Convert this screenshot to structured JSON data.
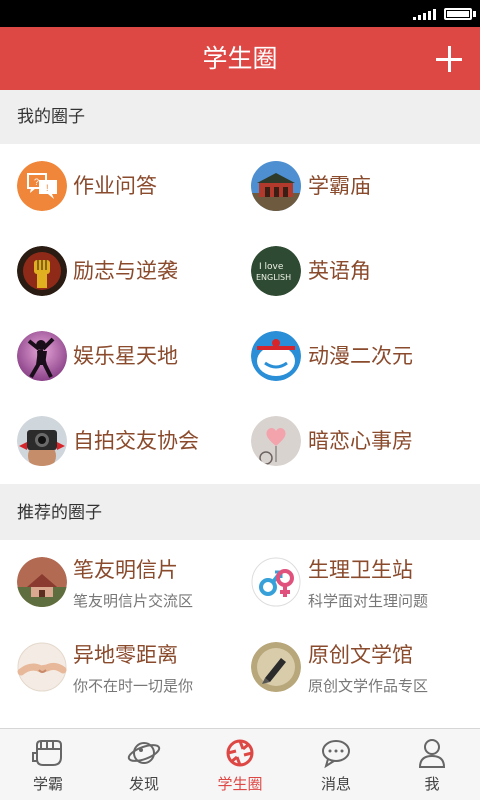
{
  "header": {
    "title": "学生圈"
  },
  "sections": {
    "mine": {
      "title": "我的圈子",
      "items": [
        {
          "name": "作业问答",
          "icon": "qa-bubbles-icon"
        },
        {
          "name": "学霸庙",
          "icon": "temple-photo-icon"
        },
        {
          "name": "励志与逆袭",
          "icon": "raised-fist-icon"
        },
        {
          "name": "英语角",
          "icon": "i-love-english-icon"
        },
        {
          "name": "娱乐星天地",
          "icon": "dancer-silhouette-icon"
        },
        {
          "name": "动漫二次元",
          "icon": "doraemon-icon"
        },
        {
          "name": "自拍交友协会",
          "icon": "camera-selfie-icon"
        },
        {
          "name": "暗恋心事房",
          "icon": "heart-balloon-icon"
        }
      ]
    },
    "recommended": {
      "title": "推荐的圈子",
      "items": [
        {
          "name": "笔友明信片",
          "desc": "笔友明信片交流区",
          "icon": "postcard-house-icon"
        },
        {
          "name": "生理卫生站",
          "desc": "科学面对生理问题",
          "icon": "gender-symbols-icon"
        },
        {
          "name": "异地零距离",
          "desc": "你不在时一切是你",
          "icon": "holding-hands-icon"
        },
        {
          "name": "原创文学馆",
          "desc": "原创文学作品专区",
          "icon": "fountain-pen-icon"
        }
      ]
    }
  },
  "tabs": [
    {
      "label": "学霸",
      "icon": "fist-icon",
      "active": false
    },
    {
      "label": "发现",
      "icon": "planet-icon",
      "active": false
    },
    {
      "label": "学生圈",
      "icon": "aperture-icon",
      "active": true
    },
    {
      "label": "消息",
      "icon": "chat-bubble-icon",
      "active": false
    },
    {
      "label": "我",
      "icon": "person-icon",
      "active": false
    }
  ],
  "colors": {
    "brand": "#dd4845",
    "name_text": "#8a4a2c"
  }
}
